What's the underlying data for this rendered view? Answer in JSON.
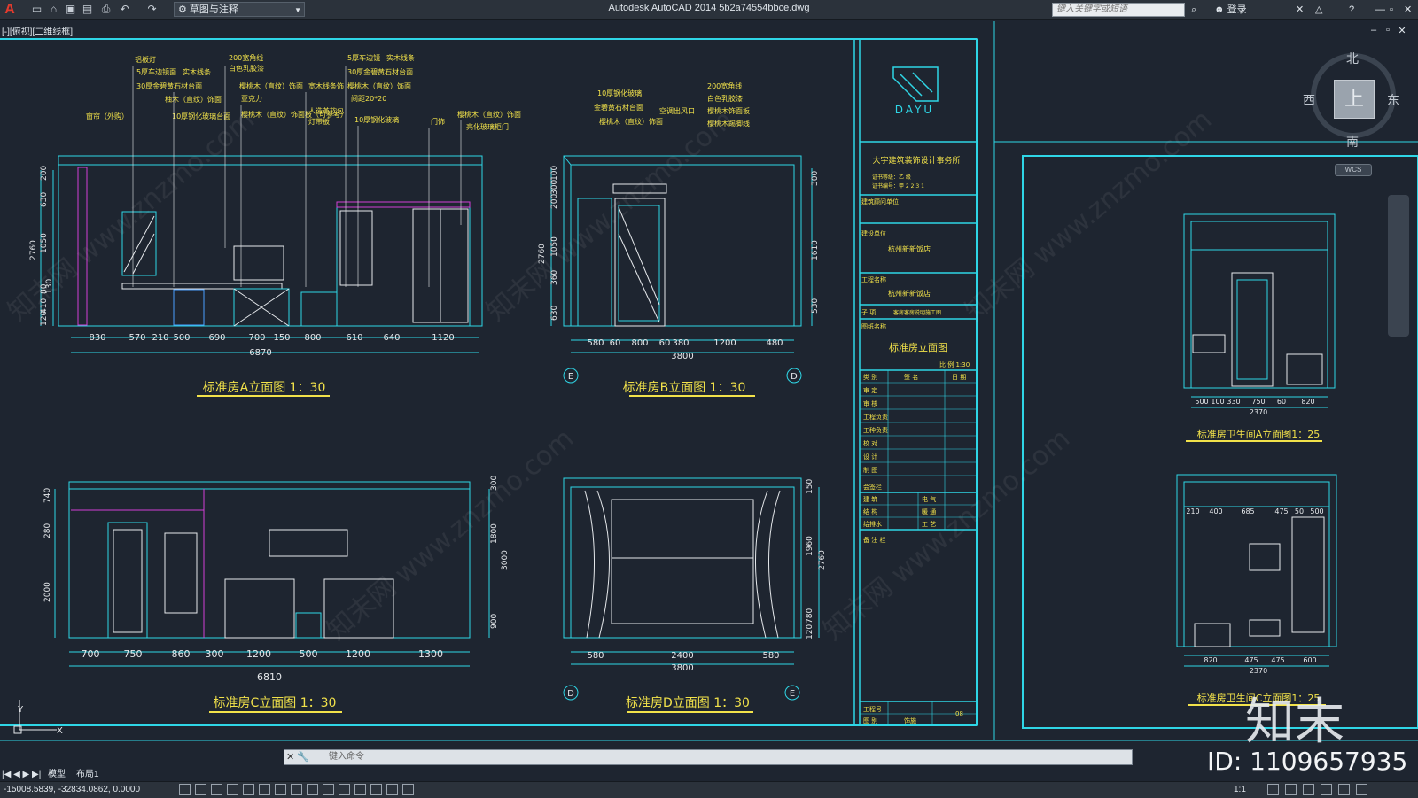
{
  "app": {
    "title": "Autodesk AutoCAD 2014    5b2a74554bbce.dwg",
    "workspace": "草图与注释",
    "search_placeholder": "键入关键字或短语",
    "login": "登录",
    "viewport_label": "[-][俯视][二维线框]"
  },
  "quick_access": [
    "new-icon",
    "open-icon",
    "save-icon",
    "saveas-icon",
    "print-icon",
    "undo-icon",
    "redo-icon"
  ],
  "compass": {
    "north": "北",
    "south": "南",
    "east": "东",
    "west": "西",
    "center": "上",
    "wcs": "WCS"
  },
  "drawing": {
    "views": [
      {
        "title": "标准房A立面图  1：30",
        "total": "6870",
        "dims": [
          "830",
          "570",
          "210",
          "500",
          "690",
          "700",
          "150",
          "800",
          "610",
          "640",
          "1120"
        ],
        "heights": [
          "200",
          "630",
          "1050",
          "80",
          "130",
          "410",
          "120",
          "2760"
        ]
      },
      {
        "title": "标准房B立面图  1：30",
        "total": "3800",
        "dims": [
          "580",
          "60",
          "800",
          "60",
          "380",
          "1200",
          "480"
        ],
        "heights": [
          "100",
          "300",
          "200",
          "1050",
          "360",
          "630",
          "2760",
          "300",
          "1610",
          "530"
        ]
      },
      {
        "title": "标准房C立面图  1：30",
        "total": "6810",
        "dims": [
          "700",
          "750",
          "860",
          "300",
          "1200",
          "500",
          "1200",
          "1300"
        ],
        "heights": [
          "740",
          "280",
          "2000",
          "300",
          "1800",
          "3000",
          "900"
        ]
      },
      {
        "title": "标准房D立面图  1：30",
        "total": "3800",
        "dims": [
          "580",
          "2400",
          "580"
        ],
        "heights": [
          "150",
          "1960",
          "2760",
          "780",
          "120"
        ]
      },
      {
        "title": "标准房卫生间A立面图1：25",
        "total": "2370",
        "dims": [
          "500",
          "100",
          "330",
          "750",
          "60",
          "820"
        ]
      },
      {
        "title": "标准房卫生间C立面图1：25",
        "total": "2370",
        "dims": [
          "820",
          "475",
          "475",
          "600"
        ],
        "top_dims": [
          "210",
          "400",
          "685",
          "475",
          "50",
          "500"
        ]
      }
    ],
    "annotations_a": [
      "铝板灯",
      "5厚车边镜面",
      "实木线条",
      "30厚金碧黄石材台面",
      "柚木（直纹）饰面",
      "10厚钢化玻璃台面",
      "窗帘（外购）",
      "200宽角线",
      "白色乳胶漆",
      "樱桃木（直纹）饰面",
      "宽木线条饰",
      "亚克力",
      "樱桃木（直纹）饰面板（可参考）",
      "人造革软包",
      "灯带板",
      "5厚车边镜",
      "实木线条",
      "30厚金碧黄石材台面",
      "樱桃木（直纹）饰面",
      "间距20*20",
      "10厚钢化玻璃",
      "门饰",
      "樱桃木（直纹）饰面",
      "亮化玻璃柜门"
    ],
    "annotations_b": [
      "10厚钢化玻璃",
      "金碧黄石材台面",
      "樱桃木（直纹）饰面",
      "200宽角线",
      "白色乳胶漆",
      "空调出风口",
      "樱桃木饰面板",
      "樱桃木踢脚线"
    ],
    "axis_marks": [
      "E",
      "D",
      "D",
      "E"
    ],
    "title_block": {
      "logo": "DAYU",
      "company": "大宇建筑装饰设计事务所",
      "cert1": "证书等级：乙 级",
      "cert2": "证书编号：甲 2 2 3 1",
      "unit_label": "建筑顾问单位",
      "client_label": "建设单位",
      "client": "杭州新新饭店",
      "project_label": "工程名称",
      "project": "杭州新新饭店",
      "item_label": "子 项",
      "item": "客房客房说明施工图",
      "drawing_name_label": "图纸名称",
      "drawing_name": "标准房立面图",
      "scale": "比 例 1:30",
      "table_header": [
        "类 别",
        "签 名",
        "日 期"
      ],
      "rows": [
        "审 定",
        "审 核",
        "工程负责",
        "工种负责",
        "校 对",
        "设 计",
        "制 图",
        "会签栏"
      ],
      "cosign": [
        [
          "建 筑",
          "电 气"
        ],
        [
          "结 构",
          "暖 通"
        ],
        [
          "给排水",
          "工 艺"
        ]
      ],
      "remarks": "备 注 栏",
      "job_no_label": "工程号",
      "sheet_no_label": "图 别",
      "sheet_type": "饰施",
      "sheet_no": "08"
    }
  },
  "command": {
    "placeholder": "键入命令"
  },
  "tabs": [
    "模型",
    "布局1"
  ],
  "status": {
    "coords": "-15008.5839,  -32834.0862,  0.0000",
    "scale": "1:1"
  },
  "watermark": {
    "logo": "知末",
    "id": "ID: 1109657935",
    "text": "知末网 www.znzmo.com"
  },
  "colors": {
    "cyan": "#2fd6e6",
    "yellow": "#f2e24a",
    "magenta": "#d23ed6",
    "white": "#e6e9ec",
    "bg": "#1e2530"
  }
}
